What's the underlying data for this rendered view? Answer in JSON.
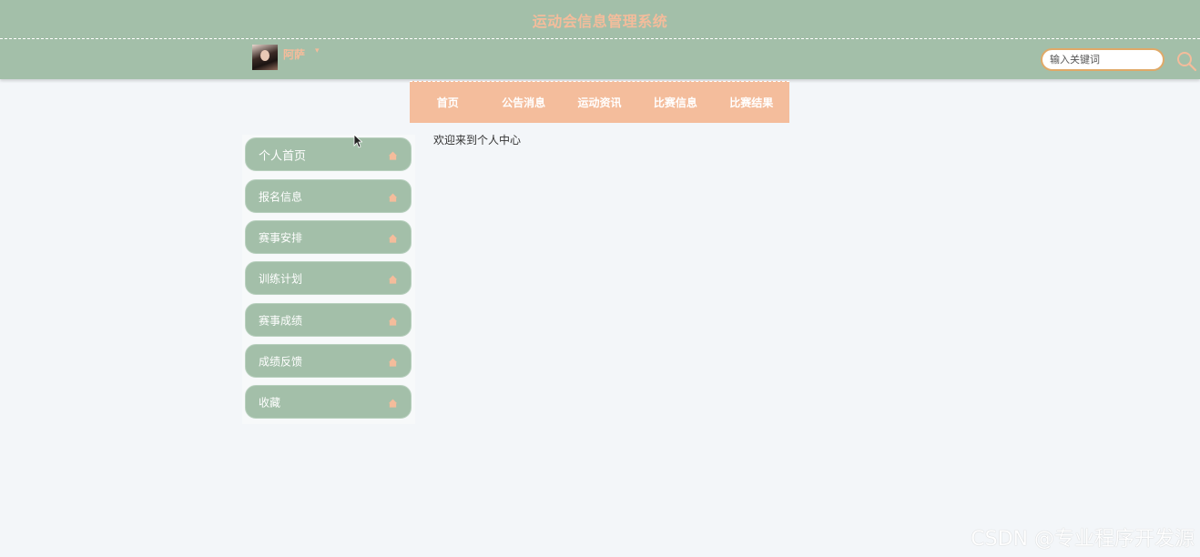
{
  "header": {
    "title": "运动会信息管理系统",
    "username": "阿萨",
    "user_menu_caret": "▾",
    "search_placeholder": "输入关键词"
  },
  "nav": {
    "items": [
      {
        "label": "首页"
      },
      {
        "label": "公告消息"
      },
      {
        "label": "运动资讯"
      },
      {
        "label": "比赛信息"
      },
      {
        "label": "比赛结果"
      }
    ]
  },
  "sidebar": {
    "items": [
      {
        "label": "个人首页",
        "icon": "home-icon"
      },
      {
        "label": "报名信息",
        "icon": "home-icon"
      },
      {
        "label": "赛事安排",
        "icon": "home-icon"
      },
      {
        "label": "训练计划",
        "icon": "home-icon"
      },
      {
        "label": "赛事成绩",
        "icon": "home-icon"
      },
      {
        "label": "成绩反馈",
        "icon": "home-icon"
      },
      {
        "label": "收藏",
        "icon": "home-icon"
      }
    ]
  },
  "main": {
    "welcome_text": "欢迎来到个人中心"
  },
  "watermark": "CSDN @专业程序开发源",
  "colors": {
    "header_bg": "#a3bfa9",
    "accent": "#f4bc9b",
    "nav_bg": "#f4bd9c",
    "page_bg": "#f3f6f9",
    "search_border": "#e0a968"
  }
}
